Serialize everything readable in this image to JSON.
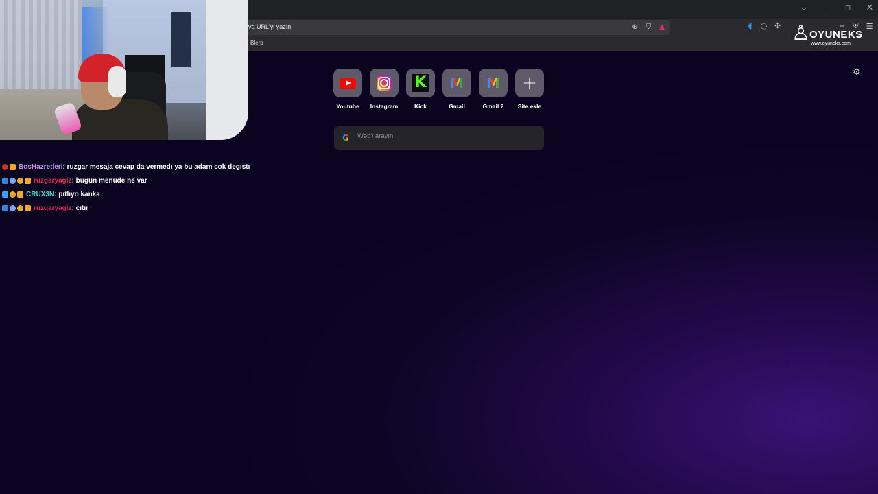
{
  "browser": {
    "omnibox_text": "ya URL'yi yazın",
    "bookmark": "Blerp",
    "window_controls": [
      "chevron-down",
      "minimize",
      "restore",
      "close"
    ]
  },
  "brand": {
    "name": "OYUNEKS",
    "url": "www.oyuneks.com"
  },
  "chat": [
    {
      "user": "BosHazretleri",
      "user_color": "#c88af0",
      "message": " : ruzgar mesaja cevap da vermedı ya bu adam cok degıstı",
      "badges": [
        "#c0392b",
        "#f2a72d"
      ]
    },
    {
      "user": "ruzgaryagiz",
      "user_color": "#d42b4f",
      "message": " : bugün menüde ne var",
      "badges": [
        "#2e86de",
        "#7aa7ff",
        "#f2a72d",
        "#f2a72d"
      ]
    },
    {
      "user": "CRUX3N",
      "user_color": "#4fd1c5",
      "message": " : pıtlıyo kanka",
      "badges": [
        "#3aa0ff",
        "#f2a72d",
        "#f2a72d"
      ]
    },
    {
      "user": "ruzgaryagiz",
      "user_color": "#d42b4f",
      "message": " : çıtır",
      "badges": [
        "#2e86de",
        "#7aa7ff",
        "#f2a72d",
        "#f2a72d"
      ]
    }
  ],
  "newtab": {
    "shortcuts": [
      {
        "label": "Youtube",
        "icon": "youtube-icon"
      },
      {
        "label": "Instagram",
        "icon": "instagram-icon"
      },
      {
        "label": "Kick",
        "icon": "kick-icon"
      },
      {
        "label": "Gmail",
        "icon": "gmail-icon"
      },
      {
        "label": "Gmail 2",
        "icon": "gmail-icon"
      },
      {
        "label": "Site ekle",
        "icon": "plus-icon"
      }
    ],
    "search_placeholder": "Web'i arayın"
  }
}
